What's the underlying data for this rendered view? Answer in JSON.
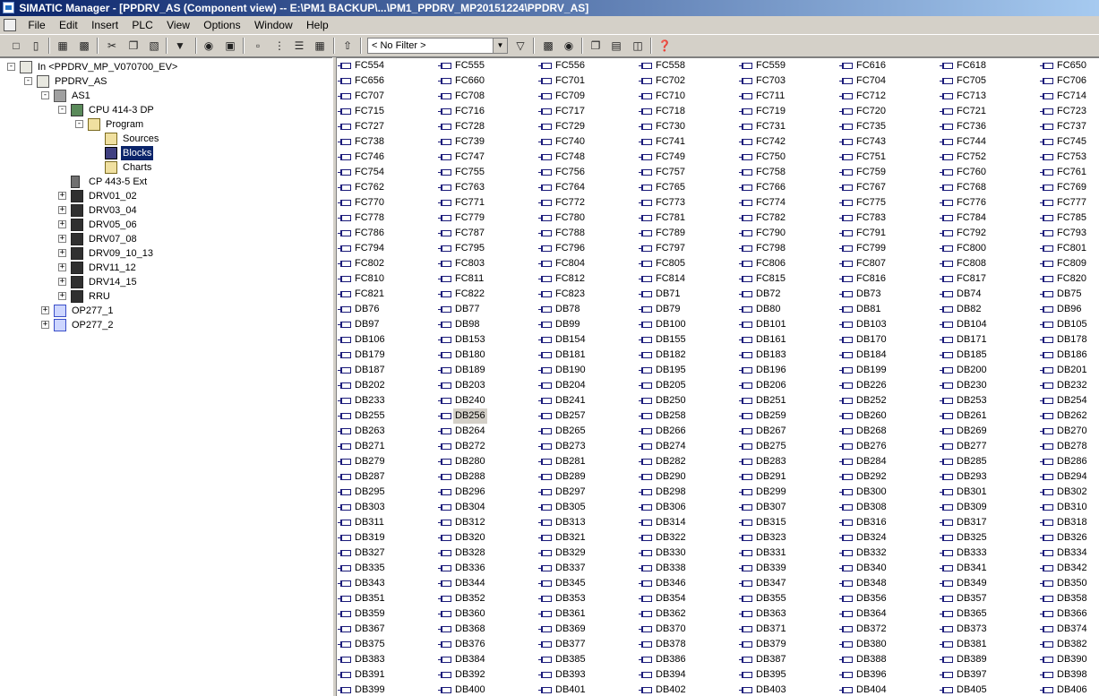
{
  "window": {
    "title": "SIMATIC Manager - [PPDRV_AS (Component view) -- E:\\PM1 BACKUP\\...\\PM1_PPDRV_MP20151224\\PPDRV_AS]"
  },
  "menu": [
    "File",
    "Edit",
    "Insert",
    "PLC",
    "View",
    "Options",
    "Window",
    "Help"
  ],
  "toolbar": {
    "filter": "< No Filter >"
  },
  "tree": [
    {
      "label": "In <PPDRV_MP_V070700_EV>",
      "icon": "multiproject-icon",
      "level": 0,
      "expander": "minus"
    },
    {
      "label": "PPDRV_AS",
      "icon": "project-icon",
      "level": 1,
      "expander": "minus"
    },
    {
      "label": "AS1",
      "icon": "station-icon",
      "level": 2,
      "expander": "minus"
    },
    {
      "label": "CPU 414-3 DP",
      "icon": "cpu-icon",
      "level": 3,
      "expander": "minus"
    },
    {
      "label": "Program",
      "icon": "program-folder-icon",
      "level": 4,
      "expander": "minus"
    },
    {
      "label": "Sources",
      "icon": "sources-folder-icon",
      "level": 5,
      "expander": ""
    },
    {
      "label": "Blocks",
      "icon": "blocks-folder-icon",
      "level": 5,
      "expander": "",
      "selected": true
    },
    {
      "label": "Charts",
      "icon": "charts-folder-icon",
      "level": 5,
      "expander": ""
    },
    {
      "label": "CP 443-5 Ext",
      "icon": "cp-icon",
      "level": 3,
      "expander": ""
    },
    {
      "label": "DRV01_02",
      "icon": "drive-icon",
      "level": 3,
      "expander": "plus"
    },
    {
      "label": "DRV03_04",
      "icon": "drive-icon",
      "level": 3,
      "expander": "plus"
    },
    {
      "label": "DRV05_06",
      "icon": "drive-icon",
      "level": 3,
      "expander": "plus"
    },
    {
      "label": "DRV07_08",
      "icon": "drive-icon",
      "level": 3,
      "expander": "plus"
    },
    {
      "label": "DRV09_10_13",
      "icon": "drive-icon",
      "level": 3,
      "expander": "plus"
    },
    {
      "label": "DRV11_12",
      "icon": "drive-icon",
      "level": 3,
      "expander": "plus"
    },
    {
      "label": "DRV14_15",
      "icon": "drive-icon",
      "level": 3,
      "expander": "plus"
    },
    {
      "label": "RRU",
      "icon": "drive-icon",
      "level": 3,
      "expander": "plus"
    },
    {
      "label": "OP277_1",
      "icon": "op-panel-icon",
      "level": 2,
      "expander": "plus"
    },
    {
      "label": "OP277_2",
      "icon": "op-panel-icon",
      "level": 2,
      "expander": "plus"
    }
  ],
  "blocks": [
    "FC554",
    "FC555",
    "FC556",
    "FC558",
    "FC559",
    "FC616",
    "FC618",
    "FC650",
    "FC656",
    "FC660",
    "FC701",
    "FC702",
    "FC703",
    "FC704",
    "FC705",
    "FC706",
    "FC707",
    "FC708",
    "FC709",
    "FC710",
    "FC711",
    "FC712",
    "FC713",
    "FC714",
    "FC715",
    "FC716",
    "FC717",
    "FC718",
    "FC719",
    "FC720",
    "FC721",
    "FC723",
    "FC727",
    "FC728",
    "FC729",
    "FC730",
    "FC731",
    "FC735",
    "FC736",
    "FC737",
    "FC738",
    "FC739",
    "FC740",
    "FC741",
    "FC742",
    "FC743",
    "FC744",
    "FC745",
    "FC746",
    "FC747",
    "FC748",
    "FC749",
    "FC750",
    "FC751",
    "FC752",
    "FC753",
    "FC754",
    "FC755",
    "FC756",
    "FC757",
    "FC758",
    "FC759",
    "FC760",
    "FC761",
    "FC762",
    "FC763",
    "FC764",
    "FC765",
    "FC766",
    "FC767",
    "FC768",
    "FC769",
    "FC770",
    "FC771",
    "FC772",
    "FC773",
    "FC774",
    "FC775",
    "FC776",
    "FC777",
    "FC778",
    "FC779",
    "FC780",
    "FC781",
    "FC782",
    "FC783",
    "FC784",
    "FC785",
    "FC786",
    "FC787",
    "FC788",
    "FC789",
    "FC790",
    "FC791",
    "FC792",
    "FC793",
    "FC794",
    "FC795",
    "FC796",
    "FC797",
    "FC798",
    "FC799",
    "FC800",
    "FC801",
    "FC802",
    "FC803",
    "FC804",
    "FC805",
    "FC806",
    "FC807",
    "FC808",
    "FC809",
    "FC810",
    "FC811",
    "FC812",
    "FC814",
    "FC815",
    "FC816",
    "FC817",
    "FC820",
    "FC821",
    "FC822",
    "FC823",
    "DB71",
    "DB72",
    "DB73",
    "DB74",
    "DB75",
    "DB76",
    "DB77",
    "DB78",
    "DB79",
    "DB80",
    "DB81",
    "DB82",
    "DB96",
    "DB97",
    "DB98",
    "DB99",
    "DB100",
    "DB101",
    "DB103",
    "DB104",
    "DB105",
    "DB106",
    "DB153",
    "DB154",
    "DB155",
    "DB161",
    "DB170",
    "DB171",
    "DB178",
    "DB179",
    "DB180",
    "DB181",
    "DB182",
    "DB183",
    "DB184",
    "DB185",
    "DB186",
    "DB187",
    "DB189",
    "DB190",
    "DB195",
    "DB196",
    "DB199",
    "DB200",
    "DB201",
    "DB202",
    "DB203",
    "DB204",
    "DB205",
    "DB206",
    "DB226",
    "DB230",
    "DB232",
    "DB233",
    "DB240",
    "DB241",
    "DB250",
    "DB251",
    "DB252",
    "DB253",
    "DB254",
    "DB255",
    "DB256",
    "DB257",
    "DB258",
    "DB259",
    "DB260",
    "DB261",
    "DB262",
    "DB263",
    "DB264",
    "DB265",
    "DB266",
    "DB267",
    "DB268",
    "DB269",
    "DB270",
    "DB271",
    "DB272",
    "DB273",
    "DB274",
    "DB275",
    "DB276",
    "DB277",
    "DB278",
    "DB279",
    "DB280",
    "DB281",
    "DB282",
    "DB283",
    "DB284",
    "DB285",
    "DB286",
    "DB287",
    "DB288",
    "DB289",
    "DB290",
    "DB291",
    "DB292",
    "DB293",
    "DB294",
    "DB295",
    "DB296",
    "DB297",
    "DB298",
    "DB299",
    "DB300",
    "DB301",
    "DB302",
    "DB303",
    "DB304",
    "DB305",
    "DB306",
    "DB307",
    "DB308",
    "DB309",
    "DB310",
    "DB311",
    "DB312",
    "DB313",
    "DB314",
    "DB315",
    "DB316",
    "DB317",
    "DB318",
    "DB319",
    "DB320",
    "DB321",
    "DB322",
    "DB323",
    "DB324",
    "DB325",
    "DB326",
    "DB327",
    "DB328",
    "DB329",
    "DB330",
    "DB331",
    "DB332",
    "DB333",
    "DB334",
    "DB335",
    "DB336",
    "DB337",
    "DB338",
    "DB339",
    "DB340",
    "DB341",
    "DB342",
    "DB343",
    "DB344",
    "DB345",
    "DB346",
    "DB347",
    "DB348",
    "DB349",
    "DB350",
    "DB351",
    "DB352",
    "DB353",
    "DB354",
    "DB355",
    "DB356",
    "DB357",
    "DB358",
    "DB359",
    "DB360",
    "DB361",
    "DB362",
    "DB363",
    "DB364",
    "DB365",
    "DB366",
    "DB367",
    "DB368",
    "DB369",
    "DB370",
    "DB371",
    "DB372",
    "DB373",
    "DB374",
    "DB375",
    "DB376",
    "DB377",
    "DB378",
    "DB379",
    "DB380",
    "DB381",
    "DB382",
    "DB383",
    "DB384",
    "DB385",
    "DB386",
    "DB387",
    "DB388",
    "DB389",
    "DB390",
    "DB391",
    "DB392",
    "DB393",
    "DB394",
    "DB395",
    "DB396",
    "DB397",
    "DB398",
    "DB399",
    "DB400",
    "DB401",
    "DB402",
    "DB403",
    "DB404",
    "DB405",
    "DB406"
  ],
  "selected_block": "DB256"
}
